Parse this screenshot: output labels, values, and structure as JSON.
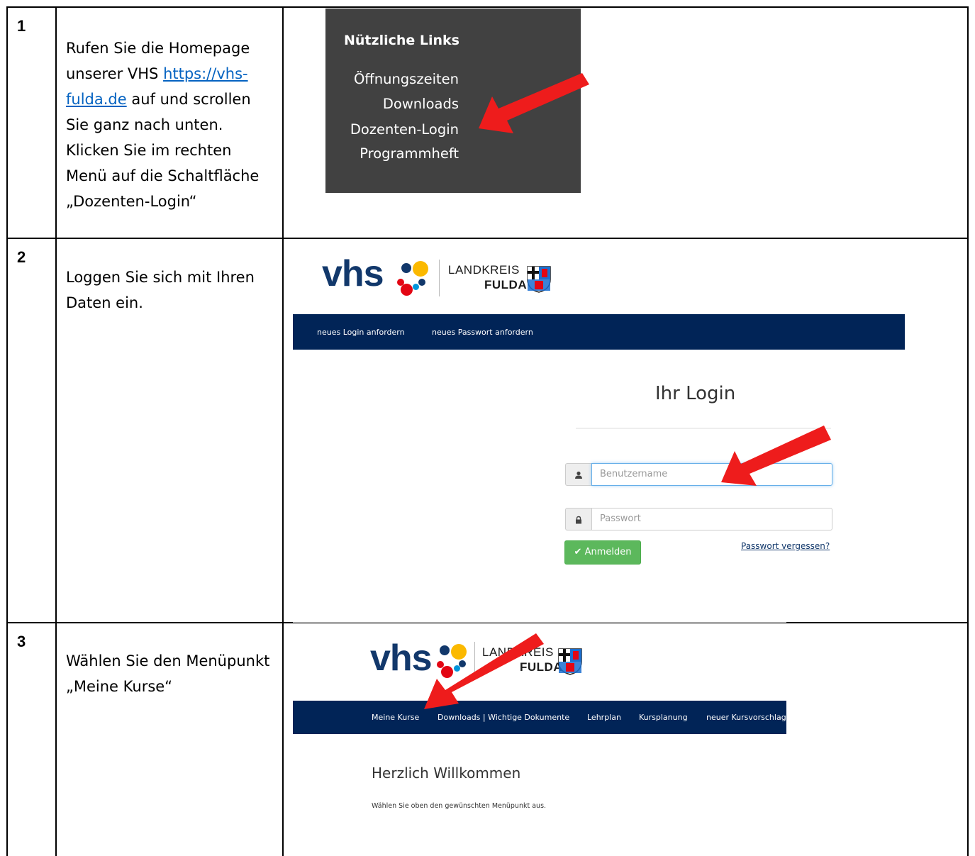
{
  "steps": [
    {
      "number": "1",
      "text_before_link": "Rufen Sie die Homepage unserer VHS",
      "link": "https://vhs-fulda.de",
      "text_after_link": "auf und scrollen Sie ganz nach unten. Klicken Sie im rechten Menü auf die Schaltfläche „Dozenten-Login“"
    },
    {
      "number": "2",
      "text": "Loggen Sie sich mit Ihren Daten ein."
    },
    {
      "number": "3",
      "text": "Wählen Sie den Menüpunkt „Meine Kurse“"
    }
  ],
  "useful_links": {
    "title": "Nützliche Links",
    "items": [
      "Öffnungszeiten",
      "Downloads",
      "Dozenten-Login",
      "Programmheft"
    ],
    "background": "#414141"
  },
  "logo": {
    "vhs_text": "vhs",
    "landkreis_line1": "LANDKREIS",
    "landkreis_line2": "FULDA",
    "brand_color": "#12386b"
  },
  "login_page": {
    "nav_items": [
      "neues Login anfordern",
      "neues Passwort anfordern"
    ],
    "title": "Ihr Login",
    "username_placeholder": "Benutzername",
    "password_placeholder": "Passwort",
    "login_button": "Anmelden",
    "forgot_link": "Passwort vergessen?",
    "nav_color": "#012457",
    "button_color": "#5cb85c"
  },
  "portal_page": {
    "nav_items": [
      "Meine Kurse",
      "Downloads | Wichtige Dokumente",
      "Lehrplan",
      "Kursplanung",
      "neuer Kursvorschlag"
    ],
    "welcome_title": "Herzlich Willkommen",
    "welcome_text": "Wählen Sie oben den gewünschten Menüpunkt aus."
  },
  "annotation_arrow_color": "#ee1c1c"
}
